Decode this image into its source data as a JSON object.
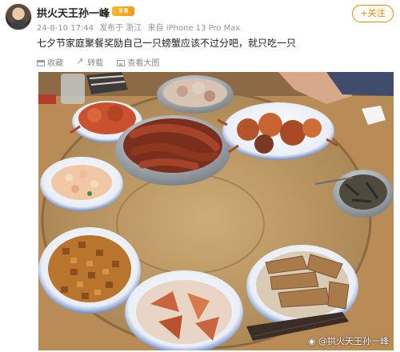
{
  "post": {
    "username": "拱火天王孙一峰",
    "vip_badge": "8",
    "datetime": "24-8-10 17:44",
    "published": "发布于 浙江",
    "source": "来自 iPhone 13 Pro Max",
    "follow_label": "+关注",
    "text": "七夕节家庭聚餐奖励自己一只螃蟹应该不过分吧，就只吃一只"
  },
  "actions": [
    {
      "label": "收藏",
      "icon": "collect-icon"
    },
    {
      "label": "转载",
      "icon": "share-icon"
    },
    {
      "label": "查看大图",
      "icon": "gallery-icon"
    }
  ],
  "photo": {
    "watermark": "@拱火天王孙一峰"
  },
  "colors": {
    "follow": "#ff8200",
    "vip": "#f5b82a",
    "meta": "#939393"
  }
}
